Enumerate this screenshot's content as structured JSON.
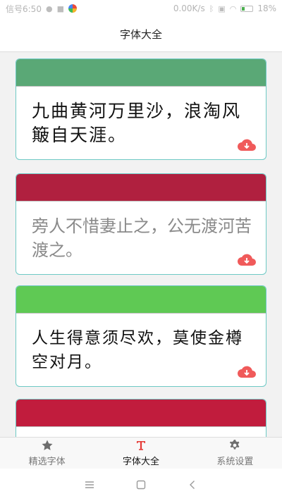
{
  "status": {
    "carrier_time": "信号6:50",
    "speed": "0.00K/s",
    "battery": "18%"
  },
  "header": {
    "title": "字体大全"
  },
  "cards": [
    {
      "header_color": "#5aa876",
      "text": "九曲黄河万里沙，浪淘风簸自天涯。",
      "style": "brush"
    },
    {
      "header_color": "#b0203f",
      "text": "旁人不惜妻止之，公无渡河苦渡之。",
      "style": "light"
    },
    {
      "header_color": "#5fc954",
      "text": "人生得意须尽欢，莫使金樽空对月。",
      "style": "hand"
    },
    {
      "header_color": "#c11c3d",
      "text": "",
      "style": "brush"
    }
  ],
  "tabs": [
    {
      "label": "精选字体",
      "icon": "star-icon",
      "active": false
    },
    {
      "label": "字体大全",
      "icon": "font-icon",
      "active": true
    },
    {
      "label": "系统设置",
      "icon": "gear-icon",
      "active": false
    }
  ],
  "colors": {
    "accent": "#e53935",
    "card_border": "#6ec9c5",
    "download": "#f05a5a"
  }
}
